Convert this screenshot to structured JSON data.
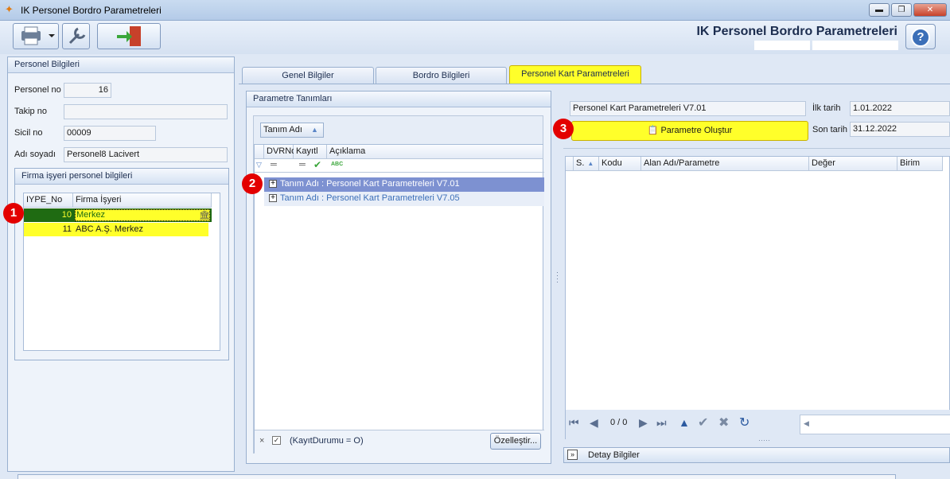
{
  "window": {
    "title": "IK Personel Bordro Parametreleri",
    "minimize": "▬",
    "restore": "❐",
    "close": "✕"
  },
  "header": {
    "app_title": "IK Personel Bordro Parametreleri",
    "help": "?"
  },
  "personel": {
    "section_title": "Personel Bilgileri",
    "fields": [
      {
        "label": "Personel no",
        "value": "16"
      },
      {
        "label": "Takip no",
        "value": ""
      },
      {
        "label": "Sicil no",
        "value": "00009"
      },
      {
        "label": "Adı soyadı",
        "value": "Personel8 Lacivert"
      }
    ],
    "firma_title": "Firma işyeri personel bilgileri",
    "firma_columns": [
      "IYPE_No",
      "Firma İşyeri"
    ],
    "firma_rows": [
      {
        "no": "10",
        "name": "Merkez"
      },
      {
        "no": "11",
        "name": "ABC A.Ş. Merkez"
      }
    ]
  },
  "tabs": [
    "Genel Bilgiler",
    "Bordro Bilgileri",
    "Personel Kart Parametreleri"
  ],
  "parametre": {
    "section_title": "Parametre Tanımları",
    "group_chip": "Tanım Adı",
    "columns": [
      "DVRNo",
      "Kayıtl",
      "Açıklama"
    ],
    "rows": [
      "Tanım Adı : Personel Kart Parametreleri V7.01",
      "Tanım Adı : Personel Kart Parametreleri V7.05"
    ],
    "filter_text": "(KayıtDurumu = O)",
    "customize_button": "Özelleştir..."
  },
  "kart": {
    "name_value": "Personel Kart Parametreleri V7.01",
    "ilk_label": "İlk tarih",
    "ilk_value": "1.01.2022",
    "son_label": "Son tarih",
    "son_value": "31.12.2022",
    "create_button": "Parametre Oluştur",
    "columns": [
      "S.",
      "Kodu",
      "Alan Adı/Parametre",
      "Değer",
      "Birim"
    ],
    "pager": "0 / 0",
    "detail_title": "Detay Bilgiler"
  },
  "badges": [
    "1",
    "2",
    "3"
  ],
  "colors": {
    "highlight": "#ffff2a",
    "selected_row": "#1f6b12",
    "badge": "#e30000"
  }
}
